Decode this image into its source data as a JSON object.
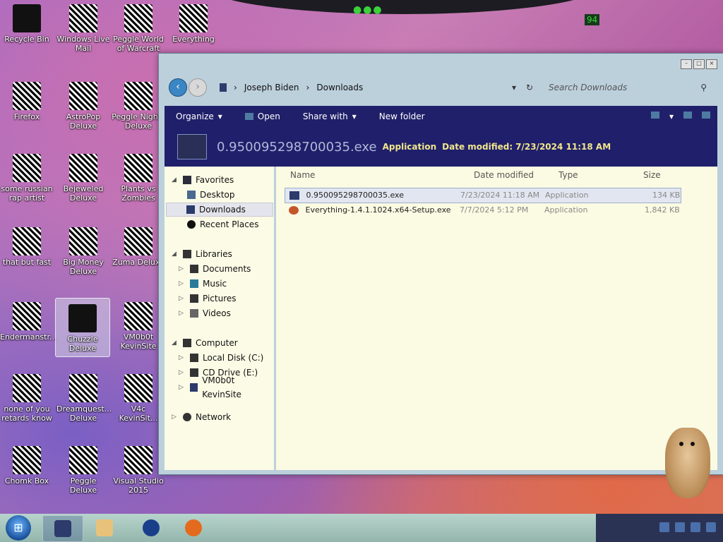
{
  "desktop": {
    "icons": [
      {
        "label": "Recycle Bin"
      },
      {
        "label": "Windows Live Mail"
      },
      {
        "label": "Peggle World of Warcraft"
      },
      {
        "label": "Everything"
      },
      {
        "label": "Firefox"
      },
      {
        "label": "AstroPop Deluxe"
      },
      {
        "label": "Peggle Nights Deluxe"
      },
      {
        "label": "some russian rap artist"
      },
      {
        "label": "Bejeweled Deluxe"
      },
      {
        "label": "Plants vs Zombies"
      },
      {
        "label": "that but fast"
      },
      {
        "label": "Big Money Deluxe"
      },
      {
        "label": "Zuma Deluxe"
      },
      {
        "label": "Endermanstr..."
      },
      {
        "label": "Chuzzle Deluxe"
      },
      {
        "label": "VM0b0t KevinSite"
      },
      {
        "label": "none of you retards know"
      },
      {
        "label": "Dreamquest... Deluxe"
      },
      {
        "label": "V4c KevinSit..."
      },
      {
        "label": "Chomk Box"
      },
      {
        "label": "Peggle Deluxe"
      },
      {
        "label": "Visual Studio 2015"
      }
    ]
  },
  "explorer": {
    "breadcrumb": [
      "Joseph Biden",
      "Downloads"
    ],
    "search_placeholder": "Search Downloads",
    "toolbar": {
      "organize": "Organize",
      "open": "Open",
      "share_with": "Share with",
      "new_folder": "New folder"
    },
    "details": {
      "name": "0.950095298700035.exe",
      "type": "Application",
      "modified_label": "Date modified:",
      "modified_value": "7/23/2024 11:18 AM"
    },
    "nav": {
      "favorites": "Favorites",
      "desktop": "Desktop",
      "downloads": "Downloads",
      "recent_places": "Recent Places",
      "libraries": "Libraries",
      "documents": "Documents",
      "music": "Music",
      "pictures": "Pictures",
      "videos": "Videos",
      "computer": "Computer",
      "local_disk": "Local Disk (C:)",
      "cd_drive": "CD Drive (E:)",
      "vm_share": "VM0b0t KevinSite",
      "network": "Network"
    },
    "columns": {
      "name": "Name",
      "date_modified": "Date modified",
      "type": "Type",
      "size": "Size"
    },
    "files": [
      {
        "name": "0.950095298700035.exe",
        "date": "7/23/2024 11:18 AM",
        "type": "Application",
        "size": "134 KB"
      },
      {
        "name": "Everything-1.4.1.1024.x64-Setup.exe",
        "date": "7/7/2024 5:12 PM",
        "type": "Application",
        "size": "1,842 KB"
      }
    ]
  },
  "taskbar": {
    "start_icon": "windows-start-orb",
    "pinned": [
      "explorer",
      "media-player",
      "globe-browser",
      "firefox"
    ]
  }
}
